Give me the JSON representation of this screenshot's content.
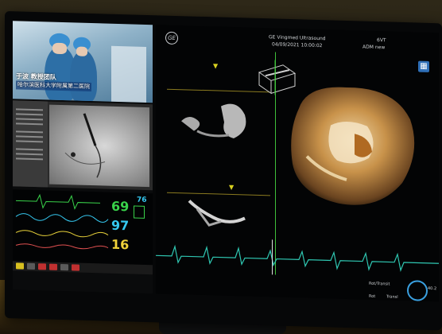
{
  "left_screen": {
    "video_caption_line1": "于波 教授团队",
    "video_caption_line2": "哈尔滨医科大学附属第二医院",
    "vitals": {
      "hr": "69",
      "spo2": "97",
      "rr": "16",
      "pr": "76",
      "hr_color": "#39d24a",
      "spo2_color": "#35c8f0",
      "rr_color": "#f0d23a"
    }
  },
  "ultrasound": {
    "logo": "GE",
    "system": "GE Vingmed Ultrasound",
    "date": "04/09/2021",
    "time": "10:00:02",
    "mode": "ADM",
    "status": "new",
    "probe": "6VT",
    "labels": {
      "left_small": "Rot/Transit",
      "right_small": "Rot",
      "mid_small": "Transl",
      "value": "40.2"
    }
  },
  "colors": {
    "ecg_green": "#2fc7b2",
    "divider_green": "#3fbf3a",
    "accent_blue": "#2f6fb7"
  }
}
